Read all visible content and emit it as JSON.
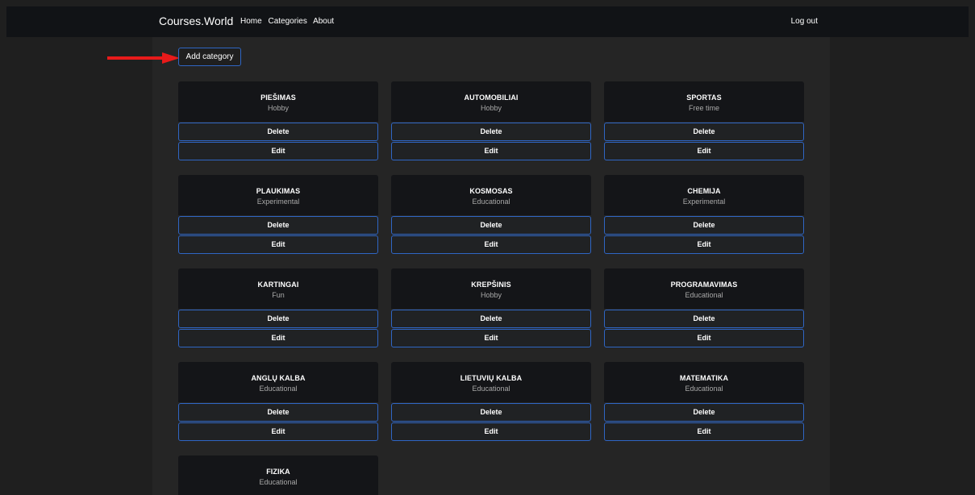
{
  "navbar": {
    "brand": "Courses.World",
    "links": [
      "Home",
      "Categories",
      "About"
    ],
    "logout": "Log out"
  },
  "actions": {
    "add_category_label": "Add category"
  },
  "card_buttons": {
    "delete_label": "Delete",
    "edit_label": "Edit"
  },
  "categories": [
    {
      "name": "PIEŠIMAS",
      "type": "Hobby"
    },
    {
      "name": "AUTOMOBILIAI",
      "type": "Hobby"
    },
    {
      "name": "SPORTAS",
      "type": "Free time"
    },
    {
      "name": "PLAUKIMAS",
      "type": "Experimental"
    },
    {
      "name": "KOSMOSAS",
      "type": "Educational"
    },
    {
      "name": "CHEMIJA",
      "type": "Experimental"
    },
    {
      "name": "KARTINGAI",
      "type": "Fun"
    },
    {
      "name": "KREPŠINIS",
      "type": "Hobby"
    },
    {
      "name": "PROGRAMAVIMAS",
      "type": "Educational"
    },
    {
      "name": "ANGLŲ KALBA",
      "type": "Educational"
    },
    {
      "name": "LIETUVIŲ KALBA",
      "type": "Educational"
    },
    {
      "name": "MATEMATIKA",
      "type": "Educational"
    },
    {
      "name": "FIZIKA",
      "type": "Educational"
    }
  ],
  "colors": {
    "accent_border": "#2f66c4",
    "annotation_arrow": "#e81a1a"
  }
}
